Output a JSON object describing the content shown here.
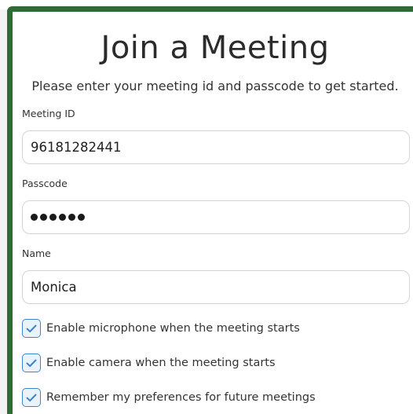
{
  "form": {
    "title": "Join a Meeting",
    "subtitle": "Please enter your meeting id and passcode to get started.",
    "meeting_id": {
      "label": "Meeting ID",
      "value": "96181282441"
    },
    "passcode": {
      "label": "Passcode",
      "masked_length": 6
    },
    "name": {
      "label": "Name",
      "value": "Monica"
    },
    "options": [
      {
        "label": "Enable microphone when the meeting starts",
        "checked": true
      },
      {
        "label": "Enable camera when the meeting starts",
        "checked": true
      },
      {
        "label": "Remember my preferences for future meetings",
        "checked": true
      }
    ]
  },
  "colors": {
    "frame_green": "#2f6b34",
    "checkbox_accent": "#3b85d0"
  },
  "icons": [
    "checkmark-icon"
  ]
}
